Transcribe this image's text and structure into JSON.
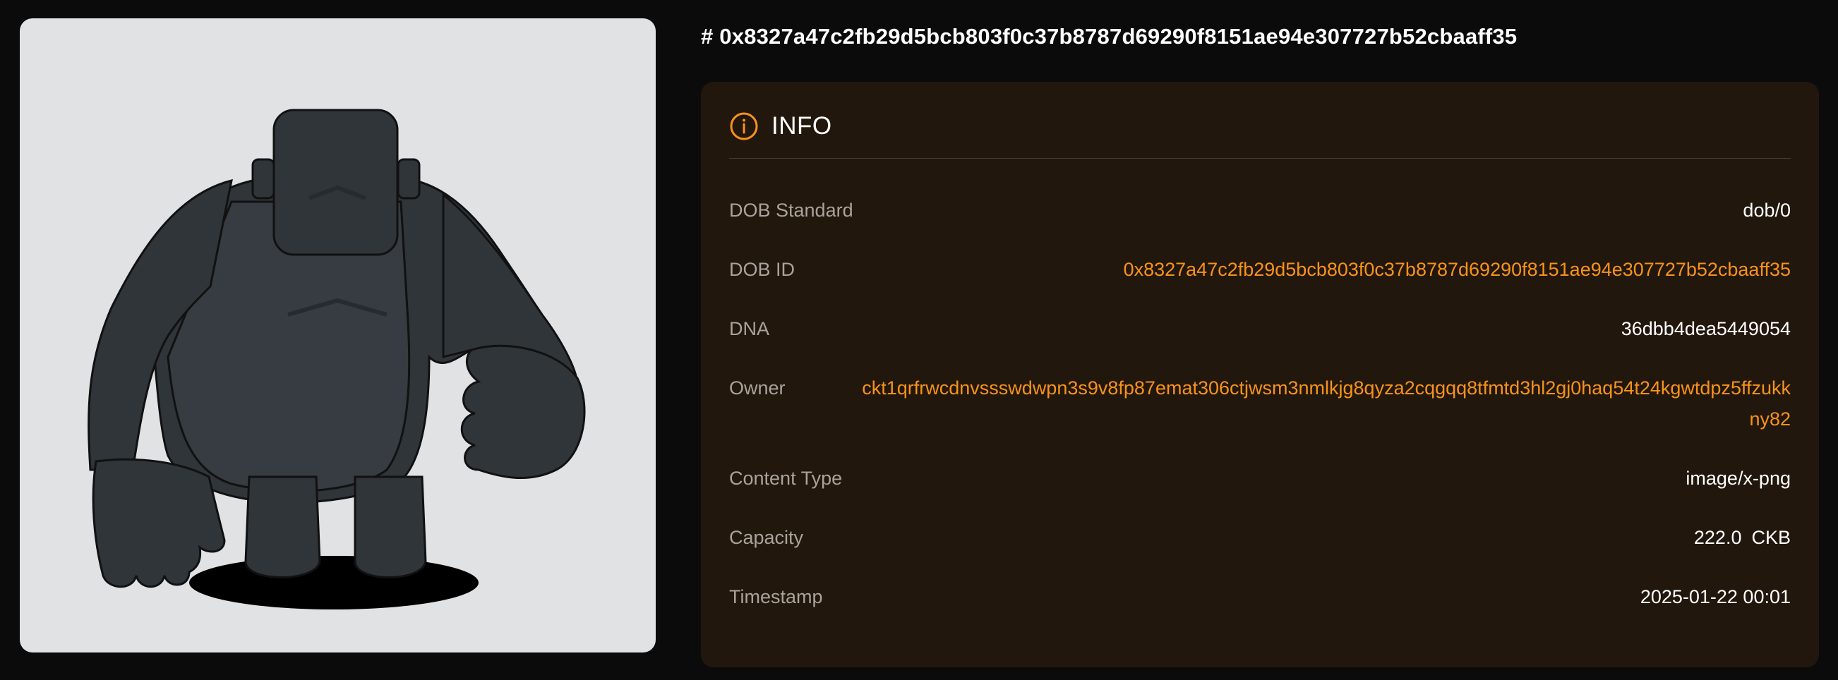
{
  "title": "# 0x8327a47c2fb29d5bcb803f0c37b8787d69290f8151ae94e307727b52cbaaff35",
  "image": {
    "alt_icon": "gorilla-character-image"
  },
  "info": {
    "icon": "info-icon",
    "heading": "INFO",
    "rows": {
      "dob_standard": {
        "label": "DOB Standard",
        "value": "dob/0"
      },
      "dob_id": {
        "label": "DOB ID",
        "value": "0x8327a47c2fb29d5bcb803f0c37b8787d69290f8151ae94e307727b52cbaaff35"
      },
      "dna": {
        "label": "DNA",
        "value": "36dbb4dea5449054"
      },
      "owner": {
        "label": "Owner",
        "value": "ckt1qrfrwcdnvssswdwpn3s9v8fp87emat306ctjwsm3nmlkjg8qyza2cqgqq8tfmtd3hl2gj0haq54t24kgwtdpz5ffzukkny82"
      },
      "content_type": {
        "label": "Content Type",
        "value": "image/x-png"
      },
      "capacity": {
        "label": "Capacity",
        "value": "222.0",
        "unit": "CKB"
      },
      "timestamp": {
        "label": "Timestamp",
        "value": "2025-01-22 00:01"
      }
    }
  },
  "colors": {
    "background": "#0b0b0b",
    "panel": "#22170d",
    "accent": "#f7931a",
    "label": "#a9a39c",
    "image_bg": "#e1e2e4",
    "character": "#2f3539"
  }
}
